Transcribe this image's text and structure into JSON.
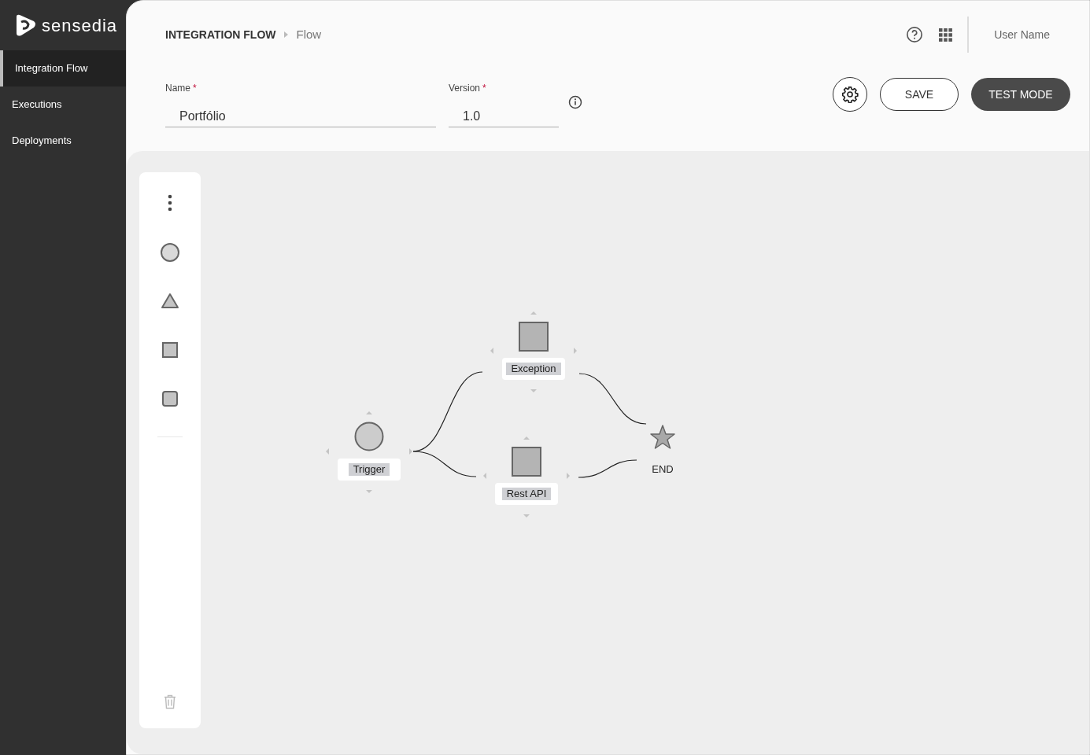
{
  "brand": {
    "name": "sensedia"
  },
  "sidebar": {
    "items": [
      {
        "label": "Integration Flow",
        "selected": true
      },
      {
        "label": "Executions",
        "selected": false
      },
      {
        "label": "Deployments",
        "selected": false
      }
    ]
  },
  "header": {
    "breadcrumb": [
      "INTEGRATION FLOW",
      "Flow"
    ],
    "user_name": "User Name"
  },
  "form": {
    "fields": [
      {
        "label": "Name",
        "required_mark": "*",
        "value": "Portfólio"
      },
      {
        "label": "Version",
        "required_mark": "*",
        "value": "1.0"
      }
    ],
    "buttons": [
      {
        "label": "SAVE",
        "kind": "outline"
      },
      {
        "label": "TEST MODE",
        "kind": "filled"
      }
    ]
  },
  "palette": {
    "shapes": [
      {
        "kind": "circle"
      },
      {
        "kind": "triangle"
      },
      {
        "kind": "square"
      },
      {
        "kind": "rounded"
      }
    ]
  },
  "diagram": {
    "nodes": [
      {
        "label": "Trigger",
        "kind": "circle"
      },
      {
        "label": "Exception",
        "kind": "square"
      },
      {
        "label": "Rest API",
        "kind": "square"
      },
      {
        "label": "END",
        "kind": "star"
      }
    ]
  }
}
